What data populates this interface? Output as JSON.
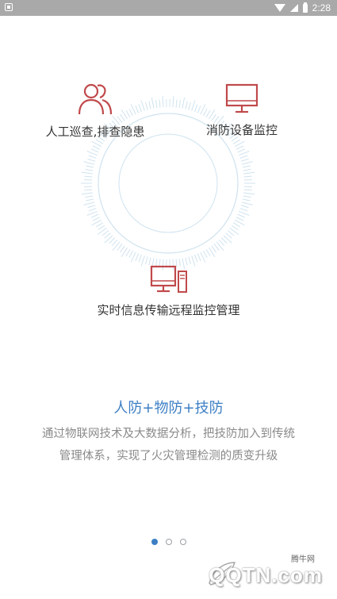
{
  "status_bar": {
    "time": "2:28"
  },
  "features": {
    "patrol": {
      "label": "人工巡查,排查隐患",
      "icon": "people-icon"
    },
    "equipment": {
      "label": "消防设备监控",
      "icon": "monitor-icon"
    },
    "remote": {
      "label": "实时信息传输远程监控管理",
      "icon": "desktop-computer-icon"
    }
  },
  "slogan": "人防+物防+技防",
  "description": {
    "line1": "通过物联网技术及大数据分析，把技防加入到传统",
    "line2": "管理体系，实现了火灾管理检测的质变升级"
  },
  "pager": {
    "total": 3,
    "active": 1
  },
  "watermark": {
    "brand": "QQTN.com",
    "subtitle": "腾牛网"
  },
  "colors": {
    "accent": "#3d7fc4",
    "icon_red": "#c0494b",
    "ring": "#cfe3f0"
  }
}
